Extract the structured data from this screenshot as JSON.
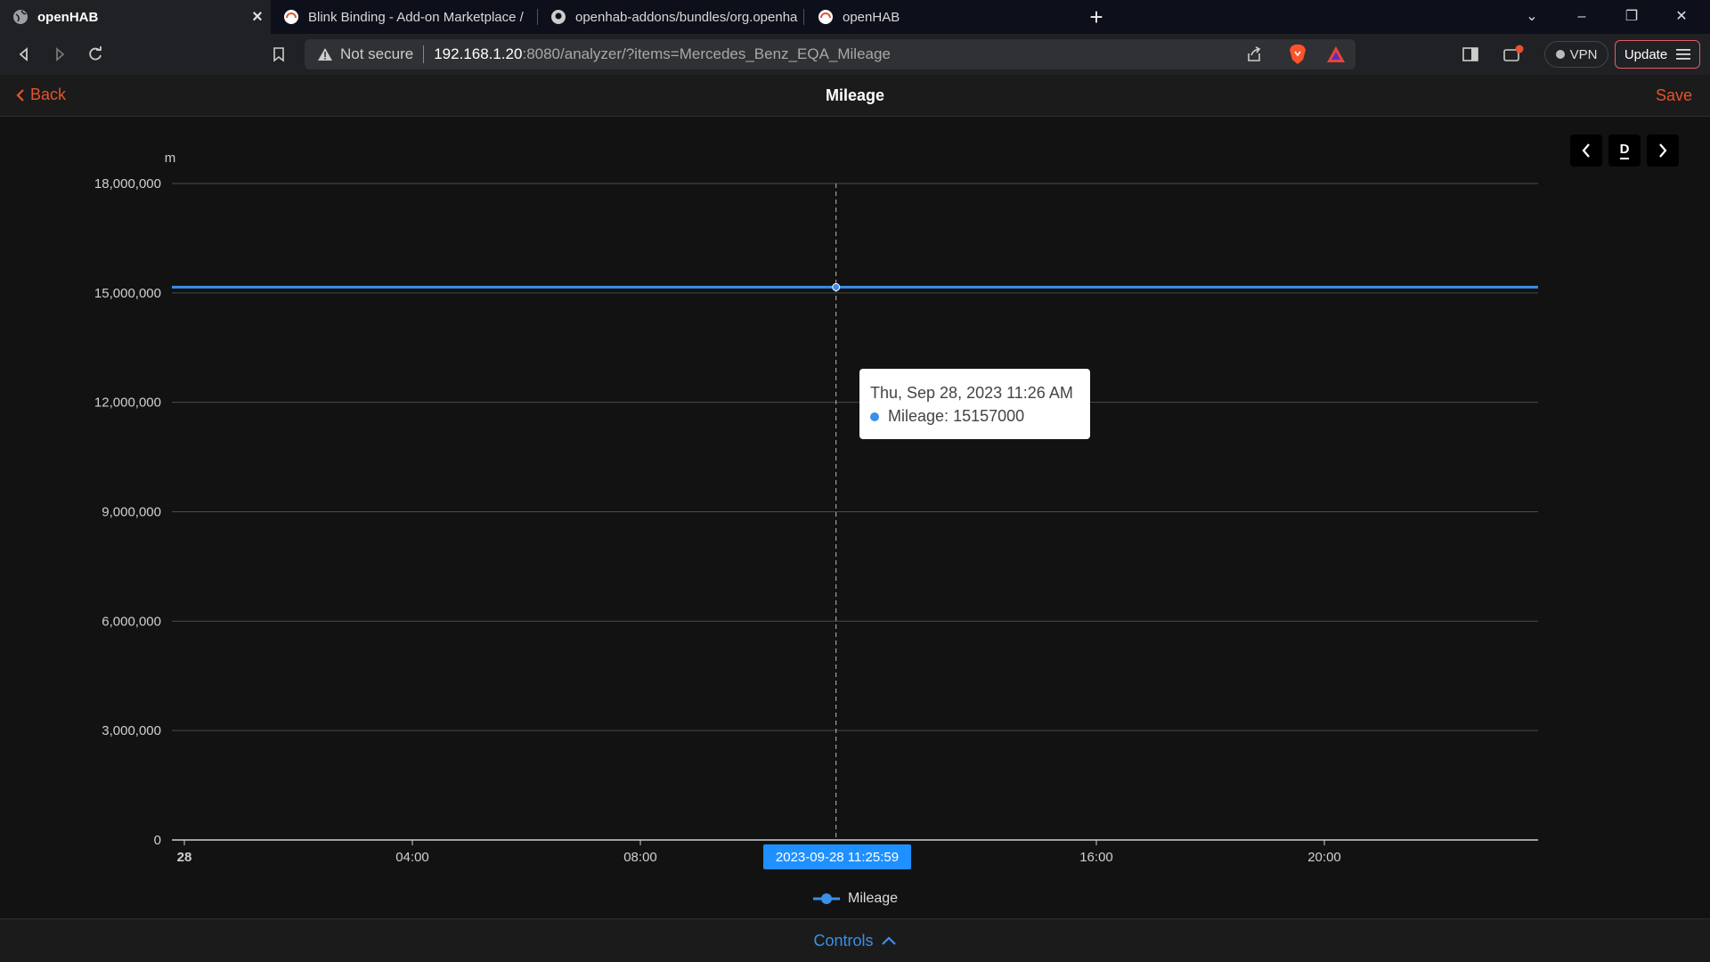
{
  "browser": {
    "tabs": [
      {
        "title": "openHAB",
        "active": true
      },
      {
        "title": "Blink Binding - Add-on Marketplace / ",
        "active": false
      },
      {
        "title": "openhab-addons/bundles/org.openha",
        "active": false
      },
      {
        "title": "openHAB",
        "active": false
      }
    ],
    "security_label": "Not secure",
    "url_host": "192.168.1.20",
    "url_rest": ":8080/analyzer/?items=Mercedes_Benz_EQA_Mileage",
    "vpn_label": "VPN",
    "update_label": "Update"
  },
  "appbar": {
    "back_label": "Back",
    "title": "Mileage",
    "save_label": "Save"
  },
  "period": {
    "current": "D"
  },
  "chart_data": {
    "type": "line",
    "title": "",
    "unit_label": "m",
    "xlabel": "",
    "ylabel": "m",
    "ylim": [
      0,
      18000000
    ],
    "yticks": [
      {
        "value": 0,
        "label": "0"
      },
      {
        "value": 3000000,
        "label": "3,000,000"
      },
      {
        "value": 6000000,
        "label": "6,000,000"
      },
      {
        "value": 9000000,
        "label": "9,000,000"
      },
      {
        "value": 12000000,
        "label": "12,000,000"
      },
      {
        "value": 15000000,
        "label": "15,000,000"
      },
      {
        "value": 18000000,
        "label": "18,000,000"
      }
    ],
    "xlim_hours": [
      0,
      24
    ],
    "xticks": [
      {
        "hour": 0,
        "label": "28",
        "bold": true
      },
      {
        "hour": 4,
        "label": "04:00",
        "bold": false
      },
      {
        "hour": 8,
        "label": "08:00",
        "bold": false
      },
      {
        "hour": 16,
        "label": "16:00",
        "bold": false
      },
      {
        "hour": 20,
        "label": "20:00",
        "bold": false
      }
    ],
    "grid": true,
    "legend_position": "bottom-center",
    "series": [
      {
        "name": "Mileage",
        "color": "#3b8fe8",
        "points": [
          {
            "hour": 0,
            "value": 15157000
          },
          {
            "hour": 11.433,
            "value": 15157000
          },
          {
            "hour": 24,
            "value": 15157000
          }
        ]
      }
    ],
    "pointer": {
      "hour": 11.433,
      "axis_label": "2023-09-28 11:25:59"
    },
    "tooltip": {
      "datetime": "Thu, Sep 28, 2023 11:26 AM",
      "series_label": "Mileage",
      "value": "15157000"
    }
  },
  "controls": {
    "label": "Controls"
  },
  "colors": {
    "accent": "#e5532d",
    "series": "#3b8fe8",
    "link": "#3b8fe8"
  }
}
